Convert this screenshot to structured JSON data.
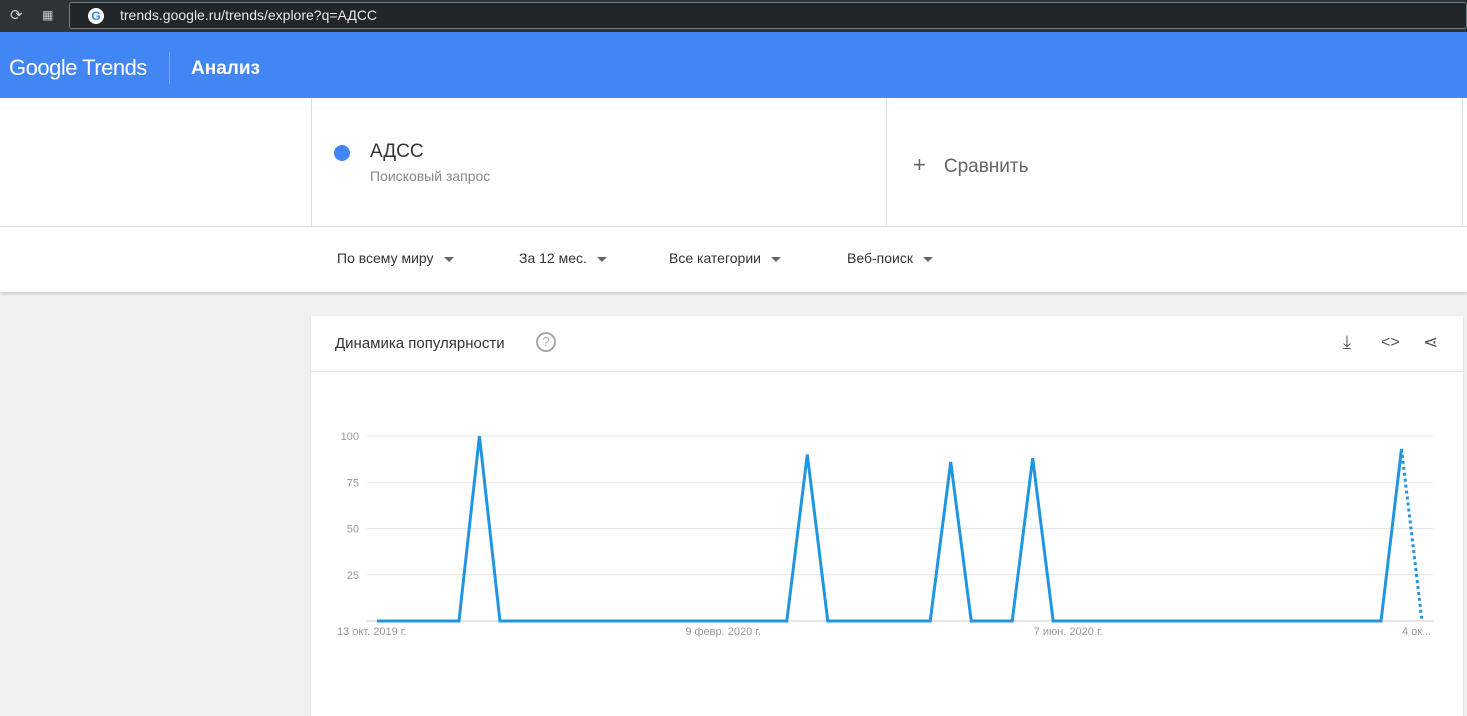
{
  "browser": {
    "url": "trends.google.ru/trends/explore?q=АДСС"
  },
  "header": {
    "logo": "Google Trends",
    "title": "Анализ"
  },
  "term": {
    "name": "АДСС",
    "subtitle": "Поисковый запрос",
    "color": "#4285f4"
  },
  "compare": {
    "label": "Сравнить"
  },
  "filters": [
    "По всему миру",
    "За 12 мес.",
    "Все категории",
    "Веб-поиск"
  ],
  "card": {
    "title": "Динамика популярности",
    "help": "?"
  },
  "chart_data": {
    "type": "line",
    "title": "Динамика популярности",
    "ylim": [
      0,
      100
    ],
    "yticks": [
      "25",
      "50",
      "75",
      "100"
    ],
    "xtick_labels": [
      {
        "week": 0,
        "label": "13 окт. 2019 г."
      },
      {
        "week": 17,
        "label": "9 февр. 2020 г."
      },
      {
        "week": 34,
        "label": "7 июн. 2020 г."
      },
      {
        "week": 51,
        "label": "4 ок..."
      }
    ],
    "series": [
      {
        "name": "АДСС",
        "color": "#2196e0",
        "values": [
          0,
          0,
          0,
          0,
          0,
          100,
          0,
          0,
          0,
          0,
          0,
          0,
          0,
          0,
          0,
          0,
          0,
          0,
          0,
          0,
          0,
          90,
          0,
          0,
          0,
          0,
          0,
          0,
          86,
          0,
          0,
          0,
          88,
          0,
          0,
          0,
          0,
          0,
          0,
          0,
          0,
          0,
          0,
          0,
          0,
          0,
          0,
          0,
          0,
          0,
          93,
          0
        ],
        "partial_last": true
      }
    ]
  }
}
